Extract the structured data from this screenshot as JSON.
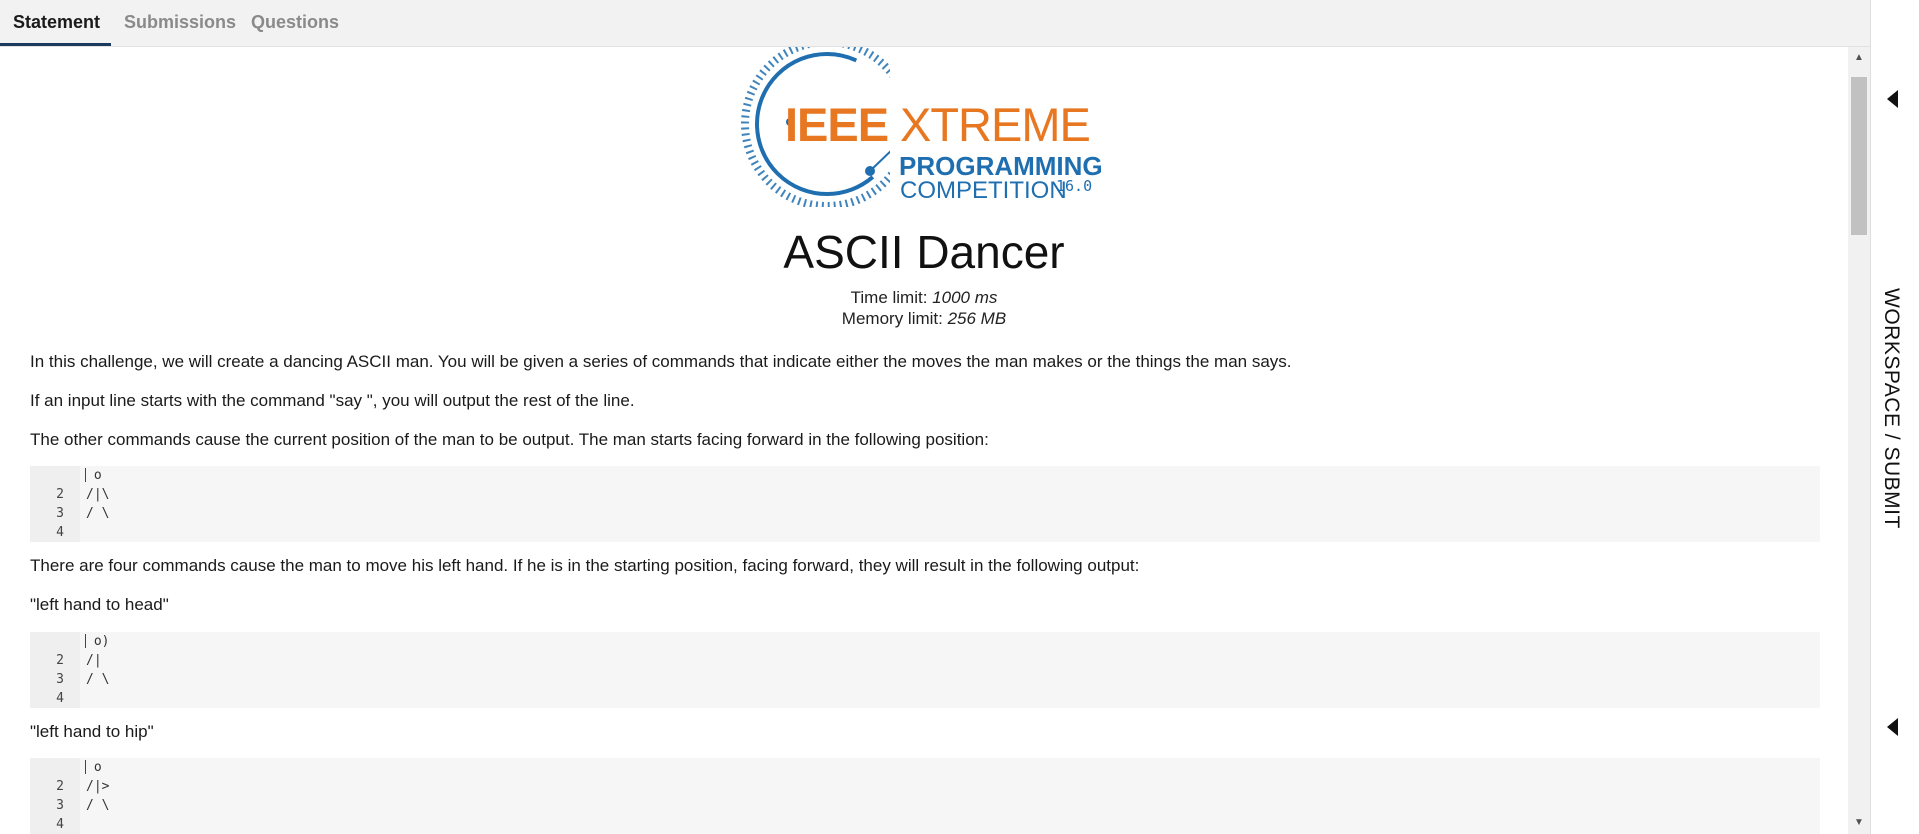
{
  "tabs": [
    {
      "label": "Statement",
      "active": true
    },
    {
      "label": "Submissions",
      "active": false
    },
    {
      "label": "Questions",
      "active": false
    }
  ],
  "logo": {
    "ieee": "IEEE",
    "xtreme": "XTREME",
    "programming": "PROGRAMMING",
    "competition": "COMPETITION",
    "version": "16.0",
    "orange": "#e87722",
    "blue": "#1f6fb0"
  },
  "problem": {
    "title": "ASCII Dancer",
    "time_limit_label": "Time limit:",
    "time_limit_value": "1000 ms",
    "memory_limit_label": "Memory limit:",
    "memory_limit_value": "256 MB"
  },
  "paragraphs": {
    "p1": "In this challenge, we will create a dancing ASCII man. You will be given a series of commands that indicate either the moves the man makes or the things the man says.",
    "p2": "If an input line starts with the command \"say \", you will output the rest of the line.",
    "p3": "The other commands cause the current position of the man to be output. The man starts facing forward in the following position:",
    "p4": "There are four commands cause the man to move his left hand. If he is in the starting position, facing forward, they will result in the following output:",
    "p5": "\"left hand to head\"",
    "p6": "\"left hand to hip\""
  },
  "code_blocks": [
    {
      "gutter": [
        "",
        "2",
        "3",
        "4"
      ],
      "lines": [
        " o",
        "/|\\",
        "/ \\",
        ""
      ]
    },
    {
      "gutter": [
        "",
        "2",
        "3",
        "4"
      ],
      "lines": [
        " o)",
        "/|",
        "/ \\",
        ""
      ]
    },
    {
      "gutter": [
        "",
        "2",
        "3",
        "4"
      ],
      "lines": [
        " o",
        "/|>",
        "/ \\",
        ""
      ]
    }
  ],
  "workspace": {
    "label": "WORKSPACE / SUBMIT"
  },
  "scrollbar": {
    "up": "▲",
    "down": "▼"
  }
}
